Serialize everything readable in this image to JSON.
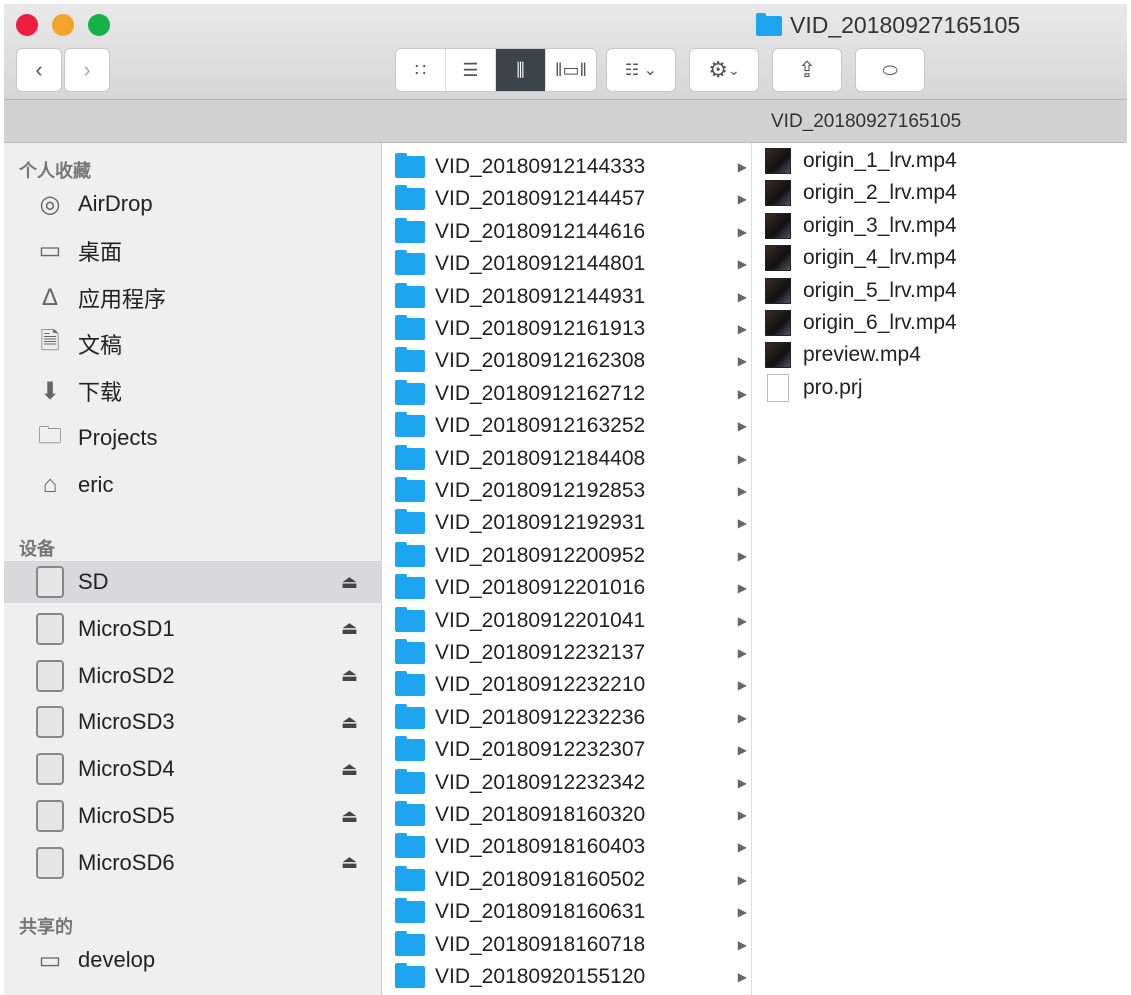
{
  "window": {
    "title": "VID_20180927165105",
    "path": "VID_20180927165105",
    "colors": {
      "close": "#ee1d3f",
      "minimize": "#f3a22a",
      "zoom": "#17b149",
      "folder": "#1ea5ef"
    }
  },
  "sidebar": {
    "sections": [
      {
        "label": "个人收藏",
        "items": [
          {
            "label": "AirDrop",
            "icon": "airdrop-icon"
          },
          {
            "label": "桌面",
            "icon": "desktop-icon"
          },
          {
            "label": "应用程序",
            "icon": "applications-icon"
          },
          {
            "label": "文稿",
            "icon": "documents-icon"
          },
          {
            "label": "下载",
            "icon": "downloads-icon"
          },
          {
            "label": "Projects",
            "icon": "folder-icon"
          },
          {
            "label": "eric",
            "icon": "home-icon"
          }
        ]
      },
      {
        "label": "设备",
        "items": [
          {
            "label": "SD",
            "icon": "drive-icon",
            "eject": true,
            "selected": true
          },
          {
            "label": "MicroSD1",
            "icon": "drive-icon",
            "eject": true
          },
          {
            "label": "MicroSD2",
            "icon": "drive-icon",
            "eject": true
          },
          {
            "label": "MicroSD3",
            "icon": "drive-icon",
            "eject": true
          },
          {
            "label": "MicroSD4",
            "icon": "drive-icon",
            "eject": true
          },
          {
            "label": "MicroSD5",
            "icon": "drive-icon",
            "eject": true
          },
          {
            "label": "MicroSD6",
            "icon": "drive-icon",
            "eject": true
          }
        ]
      },
      {
        "label": "共享的",
        "items": [
          {
            "label": "develop",
            "icon": "server-icon"
          }
        ]
      }
    ]
  },
  "column1": [
    "VID_20180912144333",
    "VID_20180912144457",
    "VID_20180912144616",
    "VID_20180912144801",
    "VID_20180912144931",
    "VID_20180912161913",
    "VID_20180912162308",
    "VID_20180912162712",
    "VID_20180912163252",
    "VID_20180912184408",
    "VID_20180912192853",
    "VID_20180912192931",
    "VID_20180912200952",
    "VID_20180912201016",
    "VID_20180912201041",
    "VID_20180912232137",
    "VID_20180912232210",
    "VID_20180912232236",
    "VID_20180912232307",
    "VID_20180912232342",
    "VID_20180918160320",
    "VID_20180918160403",
    "VID_20180918160502",
    "VID_20180918160631",
    "VID_20180918160718",
    "VID_20180920155120"
  ],
  "column2": [
    {
      "name": "origin_1_lrv.mp4",
      "type": "video"
    },
    {
      "name": "origin_2_lrv.mp4",
      "type": "video"
    },
    {
      "name": "origin_3_lrv.mp4",
      "type": "video"
    },
    {
      "name": "origin_4_lrv.mp4",
      "type": "video"
    },
    {
      "name": "origin_5_lrv.mp4",
      "type": "video"
    },
    {
      "name": "origin_6_lrv.mp4",
      "type": "video"
    },
    {
      "name": "preview.mp4",
      "type": "video"
    },
    {
      "name": "pro.prj",
      "type": "file"
    }
  ]
}
